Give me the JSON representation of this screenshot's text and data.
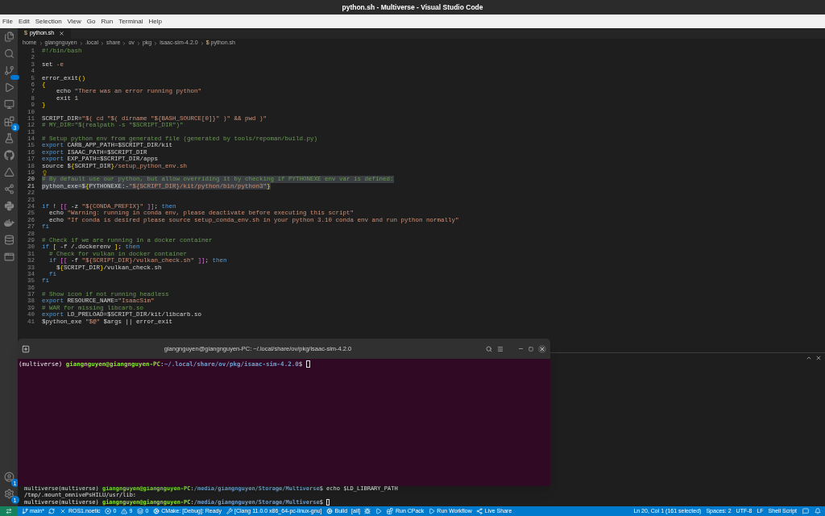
{
  "window": {
    "title": "python.sh - Multiverse - Visual Studio Code"
  },
  "menu": [
    "File",
    "Edit",
    "Selection",
    "View",
    "Go",
    "Run",
    "Terminal",
    "Help"
  ],
  "activity_bar": [
    {
      "kind": "files"
    },
    {
      "kind": "search"
    },
    {
      "kind": "scm",
      "badge": true
    },
    {
      "kind": "run"
    },
    {
      "kind": "remote"
    },
    {
      "kind": "extensions",
      "count": "3"
    },
    {
      "kind": "testing"
    },
    {
      "kind": "github"
    },
    {
      "kind": "cmake"
    },
    {
      "kind": "liveshare"
    },
    {
      "kind": "python"
    },
    {
      "kind": "docker"
    },
    {
      "kind": "database"
    },
    {
      "kind": "window"
    }
  ],
  "activity_bottom": [
    {
      "kind": "account",
      "count": "1"
    },
    {
      "kind": "settings",
      "count": "1"
    }
  ],
  "tabs": [
    {
      "glyph": "$",
      "label": "python.sh",
      "selected": true
    }
  ],
  "breadcrumb": {
    "items": [
      "home",
      "giangnguyen",
      ".local",
      "share",
      "ov",
      "pkg",
      "isaac-sim-4.2.0"
    ],
    "glyph": "$",
    "file": "python.sh"
  },
  "editor": {
    "lines": [
      {
        "number": "1",
        "selected": false,
        "lightbulb": false,
        "segments": [
          {
            "kind": "comment",
            "text": "#!/bin/bash"
          }
        ]
      },
      {
        "number": "2",
        "selected": false,
        "lightbulb": false
      },
      {
        "number": "3",
        "selected": false,
        "lightbulb": false,
        "segments": [
          {
            "kind": "plain",
            "text": "set "
          },
          {
            "kind": "string",
            "text": "-e"
          }
        ]
      },
      {
        "number": "4",
        "selected": false,
        "lightbulb": false
      },
      {
        "number": "5",
        "selected": false,
        "lightbulb": false,
        "segments": [
          {
            "kind": "plain",
            "text": "error_exit"
          },
          {
            "kind": "bracket",
            "text": "()"
          }
        ]
      },
      {
        "number": "6",
        "selected": false,
        "lightbulb": false,
        "segments": [
          {
            "kind": "bracket",
            "text": "{"
          }
        ]
      },
      {
        "number": "7",
        "selected": false,
        "lightbulb": false,
        "segments": [
          {
            "kind": "plain",
            "text": "    echo "
          },
          {
            "kind": "string",
            "text": "\"There was an error running python\""
          }
        ]
      },
      {
        "number": "8",
        "selected": false,
        "lightbulb": false,
        "segments": [
          {
            "kind": "plain",
            "text": "    exit "
          },
          {
            "kind": "number",
            "text": "1"
          }
        ]
      },
      {
        "number": "9",
        "selected": false,
        "lightbulb": false,
        "segments": [
          {
            "kind": "bracket",
            "text": "}"
          }
        ]
      },
      {
        "number": "10",
        "selected": false,
        "lightbulb": false
      },
      {
        "number": "11",
        "selected": false,
        "lightbulb": false,
        "segments": [
          {
            "kind": "plain",
            "text": "SCRIPT_DIR="
          },
          {
            "kind": "string",
            "text": "\"$( cd \"$( dirname \"${BASH_SOURCE[0]}\" )\" && pwd )\""
          }
        ]
      },
      {
        "number": "12",
        "selected": false,
        "lightbulb": false,
        "segments": [
          {
            "kind": "comment",
            "text": "# MY_DIR=\"$(realpath -s \"$SCRIPT_DIR\")\""
          }
        ]
      },
      {
        "number": "13",
        "selected": false,
        "lightbulb": false
      },
      {
        "number": "14",
        "selected": false,
        "lightbulb": false,
        "segments": [
          {
            "kind": "comment",
            "text": "# Setup python env from generated file (generated by tools/repoman/build.py)"
          }
        ]
      },
      {
        "number": "15",
        "selected": false,
        "lightbulb": false,
        "segments": [
          {
            "kind": "keyword",
            "text": "export"
          },
          {
            "kind": "plain",
            "text": " CARB_APP_PATH=$SCRIPT_DIR/kit"
          }
        ]
      },
      {
        "number": "16",
        "selected": false,
        "lightbulb": false,
        "segments": [
          {
            "kind": "keyword",
            "text": "export"
          },
          {
            "kind": "plain",
            "text": " ISAAC_PATH=$SCRIPT_DIR"
          }
        ]
      },
      {
        "number": "17",
        "selected": false,
        "lightbulb": false,
        "segments": [
          {
            "kind": "keyword",
            "text": "export"
          },
          {
            "kind": "plain",
            "text": " EXP_PATH=$SCRIPT_DIR/apps"
          }
        ]
      },
      {
        "number": "18",
        "selected": false,
        "lightbulb": false,
        "segments": [
          {
            "kind": "plain",
            "text": "source $"
          },
          {
            "kind": "bracket",
            "text": "{"
          },
          {
            "kind": "plain",
            "text": "SCRIPT_DIR"
          },
          {
            "kind": "bracket",
            "text": "}"
          },
          {
            "kind": "string",
            "text": "/setup_python_env.sh"
          }
        ]
      },
      {
        "number": "19",
        "selected": false,
        "lightbulb": true
      },
      {
        "number": "20",
        "selected": true,
        "lightbulb": false,
        "segments": [
          {
            "kind": "comment",
            "text": "# By default use our python, but allow overriding it by checking if PYTHONEXE env var is defined:"
          }
        ]
      },
      {
        "number": "21",
        "selected": true,
        "lightbulb": false,
        "segments": [
          {
            "kind": "plain",
            "text": "python_exe=$"
          },
          {
            "kind": "bracket",
            "text": "{"
          },
          {
            "kind": "plain",
            "text": "PYTHONEXE:-"
          },
          {
            "kind": "string",
            "text": "\"${SCRIPT_DIR}/kit/python/bin/python3\""
          },
          {
            "kind": "bracket",
            "text": "}"
          }
        ]
      },
      {
        "number": "22",
        "selected": false,
        "lightbulb": false
      },
      {
        "number": "23",
        "selected": false,
        "lightbulb": false
      },
      {
        "number": "24",
        "selected": false,
        "lightbulb": false,
        "segments": [
          {
            "kind": "keyword",
            "text": "if"
          },
          {
            "kind": "plain",
            "text": " ! "
          },
          {
            "kind": "bracket2",
            "text": "[["
          },
          {
            "kind": "plain",
            "text": " -z "
          },
          {
            "kind": "string",
            "text": "\"${CONDA_PREFIX}\""
          },
          {
            "kind": "bracket2",
            "text": " ]]"
          },
          {
            "kind": "plain",
            "text": "; "
          },
          {
            "kind": "keyword",
            "text": "then"
          }
        ]
      },
      {
        "number": "25",
        "selected": false,
        "lightbulb": false,
        "segments": [
          {
            "kind": "plain",
            "text": "  echo "
          },
          {
            "kind": "string",
            "text": "\"Warning: running in conda env, please deactivate before executing this script\""
          }
        ]
      },
      {
        "number": "26",
        "selected": false,
        "lightbulb": false,
        "segments": [
          {
            "kind": "plain",
            "text": "  echo "
          },
          {
            "kind": "string",
            "text": "\"If conda is desired please source setup_conda_env.sh in your python 3.10 conda env and run python normally\""
          }
        ]
      },
      {
        "number": "27",
        "selected": false,
        "lightbulb": false,
        "segments": [
          {
            "kind": "keyword",
            "text": "fi"
          }
        ]
      },
      {
        "number": "28",
        "selected": false,
        "lightbulb": false
      },
      {
        "number": "29",
        "selected": false,
        "lightbulb": false,
        "segments": [
          {
            "kind": "comment",
            "text": "# Check if we are running in a docker container"
          }
        ]
      },
      {
        "number": "30",
        "selected": false,
        "lightbulb": false,
        "segments": [
          {
            "kind": "keyword",
            "text": "if"
          },
          {
            "kind": "bracket",
            "text": " ["
          },
          {
            "kind": "plain",
            "text": " -f /.dockerenv "
          },
          {
            "kind": "bracket",
            "text": "]"
          },
          {
            "kind": "plain",
            "text": "; "
          },
          {
            "kind": "keyword",
            "text": "then"
          }
        ]
      },
      {
        "number": "31",
        "selected": false,
        "lightbulb": false,
        "segments": [
          {
            "kind": "comment",
            "text": "  # Check for vulkan in docker container"
          }
        ]
      },
      {
        "number": "32",
        "selected": false,
        "lightbulb": false,
        "segments": [
          {
            "kind": "keyword",
            "text": "  if"
          },
          {
            "kind": "bracket2",
            "text": " [["
          },
          {
            "kind": "plain",
            "text": " -f "
          },
          {
            "kind": "string",
            "text": "\"${SCRIPT_DIR}/vulkan_check.sh\""
          },
          {
            "kind": "bracket2",
            "text": " ]]"
          },
          {
            "kind": "plain",
            "text": "; "
          },
          {
            "kind": "keyword",
            "text": "then"
          }
        ]
      },
      {
        "number": "33",
        "selected": false,
        "lightbulb": false,
        "segments": [
          {
            "kind": "plain",
            "text": "    $"
          },
          {
            "kind": "bracket",
            "text": "{"
          },
          {
            "kind": "plain",
            "text": "SCRIPT_DIR"
          },
          {
            "kind": "bracket",
            "text": "}"
          },
          {
            "kind": "plain",
            "text": "/vulkan_check.sh"
          }
        ]
      },
      {
        "number": "34",
        "selected": false,
        "lightbulb": false,
        "segments": [
          {
            "kind": "keyword",
            "text": "  fi"
          }
        ]
      },
      {
        "number": "35",
        "selected": false,
        "lightbulb": false,
        "segments": [
          {
            "kind": "keyword",
            "text": "fi"
          }
        ]
      },
      {
        "number": "36",
        "selected": false,
        "lightbulb": false
      },
      {
        "number": "37",
        "selected": false,
        "lightbulb": false,
        "segments": [
          {
            "kind": "comment",
            "text": "# Show icon if not running headless"
          }
        ]
      },
      {
        "number": "38",
        "selected": false,
        "lightbulb": false,
        "segments": [
          {
            "kind": "keyword",
            "text": "export"
          },
          {
            "kind": "plain",
            "text": " RESOURCE_NAME="
          },
          {
            "kind": "string",
            "text": "\"IsaacSim\""
          }
        ]
      },
      {
        "number": "39",
        "selected": false,
        "lightbulb": false,
        "segments": [
          {
            "kind": "comment",
            "text": "# WAR for missing libcarb.so"
          }
        ]
      },
      {
        "number": "40",
        "selected": false,
        "lightbulb": false,
        "segments": [
          {
            "kind": "keyword",
            "text": "export"
          },
          {
            "kind": "plain",
            "text": " LD_PRELOAD=$SCRIPT_DIR/kit/libcarb.so"
          }
        ]
      },
      {
        "number": "41",
        "selected": false,
        "lightbulb": false,
        "segments": [
          {
            "kind": "plain",
            "text": "$python_exe "
          },
          {
            "kind": "string",
            "text": "\"$@\""
          },
          {
            "kind": "plain",
            "text": " $args || error_exit"
          }
        ]
      }
    ]
  },
  "panel_terminal": {
    "lines": [
      {
        "segments": [
          {
            "kind": "plain",
            "text": "multiverse(multiverse) "
          },
          {
            "kind": "user",
            "text": "giangnguyen@giangnguyen-PC"
          },
          {
            "kind": "plain",
            "text": ":"
          },
          {
            "kind": "path",
            "text": "/media/giangnguyen/Storage/Multiverse"
          },
          {
            "kind": "plain",
            "text": "$ echo $LD_LIBRARY_PATH"
          }
        ],
        "cursor": false
      },
      {
        "segments": [
          {
            "kind": "plain",
            "text": "/tmp/.mount_omnivePsHILU/usr/lib:"
          }
        ],
        "cursor": false
      },
      {
        "segments": [
          {
            "kind": "plain",
            "text": "multiverse(multiverse) "
          },
          {
            "kind": "user",
            "text": "giangnguyen@giangnguyen-PC"
          },
          {
            "kind": "plain",
            "text": ":"
          },
          {
            "kind": "path",
            "text": "/media/giangnguyen/Storage/Multiverse"
          },
          {
            "kind": "plain",
            "text": "$ "
          }
        ],
        "cursor": true
      }
    ]
  },
  "terminal_window": {
    "title": "giangnguyen@giangnguyen-PC: ~/.local/share/ov/pkg/isaac-sim-4.2.0",
    "prompt": [
      {
        "kind": "plain",
        "text": "(multiverse) "
      },
      {
        "kind": "user",
        "text": "giangnguyen@giangnguyen-PC"
      },
      {
        "kind": "plain",
        "text": ":"
      },
      {
        "kind": "path",
        "text": "~/.local/share/ov/pkg/isaac-sim-4.2.0"
      },
      {
        "kind": "plain",
        "text": "$ "
      }
    ]
  },
  "status_bar": {
    "left": [
      {
        "kind": "remote"
      },
      {
        "kind": "branch",
        "text": "main*"
      },
      {
        "kind": "sync"
      },
      {
        "kind": "ros",
        "text": "ROS1.noetic"
      },
      {
        "kind": "errors",
        "text": "0"
      },
      {
        "kind": "warnings",
        "text": "9"
      },
      {
        "kind": "w",
        "text": "0"
      },
      {
        "kind": "cmake",
        "text": "CMake: [Debug]: Ready"
      },
      {
        "kind": "kit",
        "text": "[Clang 11.0.0 x86_64-pc-linux-gnu]"
      },
      {
        "kind": "build",
        "text": "Build"
      },
      {
        "kind": "plain",
        "text": "[all]"
      },
      {
        "kind": "debug"
      },
      {
        "kind": "play"
      },
      {
        "kind": "cpack",
        "text": "Run CPack"
      },
      {
        "kind": "play",
        "text": "Run Workflow"
      },
      {
        "kind": "liveshare",
        "text": "Live Share"
      }
    ],
    "right": [
      {
        "kind": "plain",
        "text": "Ln 20, Col 1 (161 selected)"
      },
      {
        "kind": "plain",
        "text": "Spaces: 2"
      },
      {
        "kind": "plain",
        "text": "UTF-8"
      },
      {
        "kind": "plain",
        "text": "LF"
      },
      {
        "kind": "plain",
        "text": "Shell Script"
      },
      {
        "kind": "feedback"
      },
      {
        "kind": "bell"
      }
    ]
  }
}
